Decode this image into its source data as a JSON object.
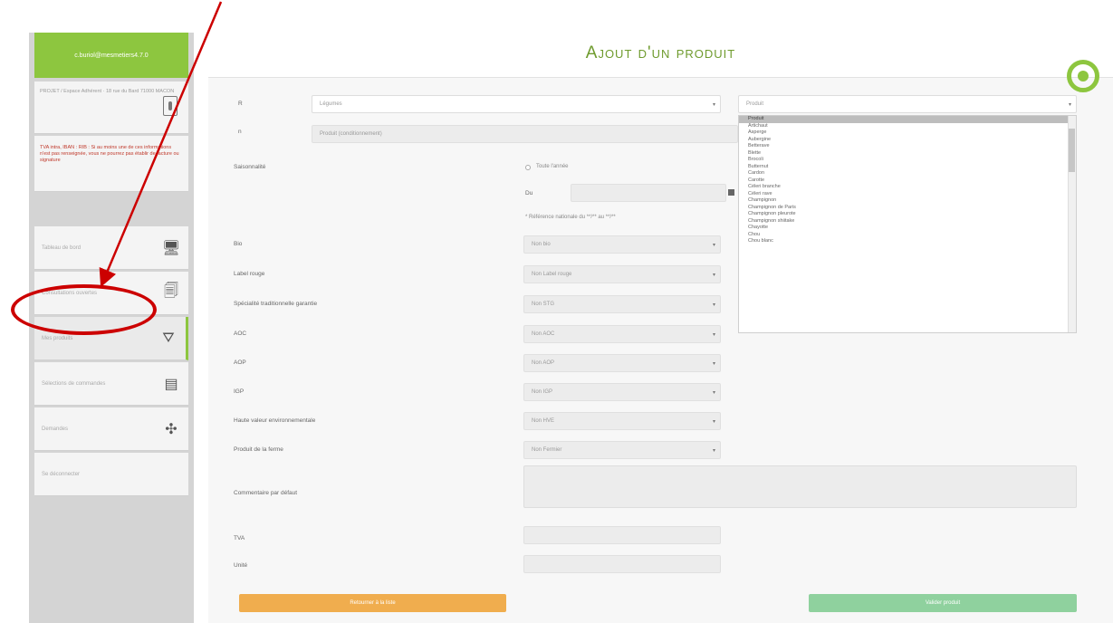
{
  "sidebar": {
    "user": "c.buriol@mesmetiers4.7.0",
    "address": "PROJET / Espace Adhérent · 18 rue du Bard 71000 MACON",
    "warning": "TVA intra, IBAN : RIB : Si au moins une de ces informations n'est pas renseignée, vous ne pourrez pas établir de facture ou signature",
    "items": [
      {
        "label": "Tableau de bord",
        "icon": "dashboard-icon"
      },
      {
        "label": "Consultations ouvertes",
        "icon": "documents-icon"
      },
      {
        "label": "Mes produits",
        "icon": "products-icon"
      },
      {
        "label": "Sélections de commandes",
        "icon": "orders-icon"
      },
      {
        "label": "Demandes",
        "icon": "network-icon"
      },
      {
        "label": "Se déconnecter",
        "icon": ""
      }
    ]
  },
  "header": {
    "title": "Ajout d'un produit"
  },
  "form": {
    "row1_label": "R",
    "category_value": "Légumes",
    "product_select_value": "Produit",
    "row2_label": "n",
    "row2_value": "Produit (conditionnement)",
    "saisonnalite_label": "Saisonnalité",
    "toute_annee": "Toute l'année",
    "du_label": "Du",
    "reference_note": "* Référence nationale du **/** au **/**",
    "bio_label": "Bio",
    "bio_value": "Non bio",
    "label_rouge_label": "Label rouge",
    "label_rouge_value": "Non Label rouge",
    "stg_label": "Spécialité traditionnelle garantie",
    "stg_value": "Non STG",
    "aoc_label": "AOC",
    "aoc_value": "Non AOC",
    "aop_label": "AOP",
    "aop_value": "Non AOP",
    "igp_label": "IGP",
    "igp_value": "Non IGP",
    "hve_label": "Haute valeur environnementale",
    "hve_value": "Non HVE",
    "ferme_label": "Produit de la ferme",
    "ferme_value": "Non Fermier",
    "comment_label": "Commentaire par défaut",
    "tva_label": "TVA",
    "unite_label": "Unité"
  },
  "dropdown_options": [
    "Produit",
    "Artichaut",
    "Asperge",
    "Aubergine",
    "Betterave",
    "Blette",
    "Brocoli",
    "Butternut",
    "Cardon",
    "Carotte",
    "Céleri branche",
    "Céleri rave",
    "Champignon",
    "Champignon de Paris",
    "Champignon pleurote",
    "Champignon shiitake",
    "Chayotte",
    "Chou",
    "Chou blanc"
  ],
  "buttons": {
    "back": "Retourner à la liste",
    "validate": "Valider produit"
  },
  "colors": {
    "brand_green": "#8dc63f",
    "title_green": "#6f9b2e",
    "back_orange": "#f0ad4e",
    "valid_green": "#8fd19e",
    "annotation_red": "#c00000"
  }
}
